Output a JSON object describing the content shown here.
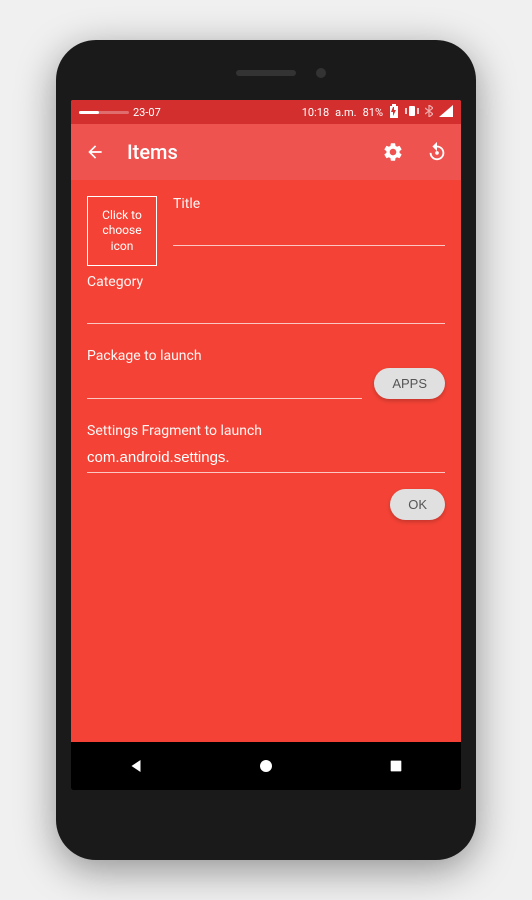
{
  "status": {
    "time_small": "23-07",
    "time": "10:18",
    "ampm": "a.m.",
    "battery": "81%"
  },
  "appbar": {
    "title": "Items"
  },
  "form": {
    "icon_chooser": "Click to choose icon",
    "title_label": "Title",
    "title_value": "",
    "category_label": "Category",
    "category_value": "",
    "package_label": "Package to launch",
    "package_value": "",
    "apps_btn": "APPS",
    "fragment_label": "Settings Fragment to launch",
    "fragment_value": "com.android.settings.",
    "ok_btn": "OK"
  }
}
